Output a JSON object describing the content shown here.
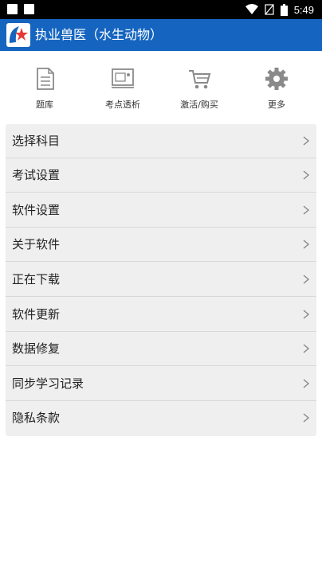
{
  "status_bar": {
    "time": "5:49"
  },
  "header": {
    "title": "执业兽医（水生动物）"
  },
  "toolbar": [
    {
      "label": "题库",
      "icon": "document-icon"
    },
    {
      "label": "考点透析",
      "icon": "presentation-icon"
    },
    {
      "label": "激活/购买",
      "icon": "cart-icon"
    },
    {
      "label": "更多",
      "icon": "gear-icon"
    }
  ],
  "menu": [
    {
      "label": "选择科目"
    },
    {
      "label": "考试设置"
    },
    {
      "label": "软件设置"
    },
    {
      "label": "关于软件"
    },
    {
      "label": "正在下载"
    },
    {
      "label": "软件更新"
    },
    {
      "label": "数据修复"
    },
    {
      "label": "同步学习记录"
    },
    {
      "label": "隐私条款"
    }
  ],
  "colors": {
    "header_bg": "#1565c0",
    "menu_bg": "#efefef",
    "icon_gray": "#9e9e9e"
  }
}
